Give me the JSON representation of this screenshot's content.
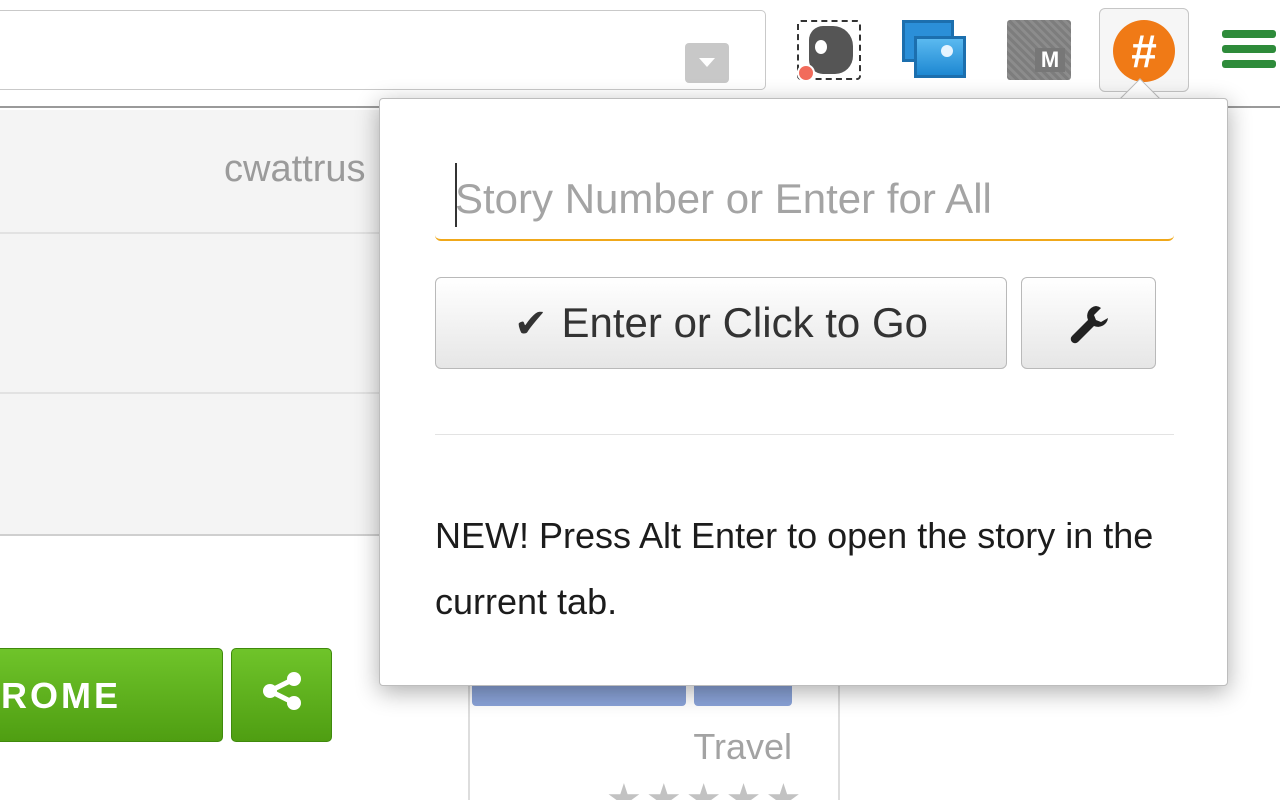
{
  "toolbar": {
    "extensions": [
      {
        "name": "evernote-web-clipper",
        "icon": "elephant-icon"
      },
      {
        "name": "image-extension",
        "icon": "images-icon"
      },
      {
        "name": "medium-extension",
        "icon": "m-icon",
        "glyph": "M"
      },
      {
        "name": "story-number-extension",
        "icon": "hash-icon",
        "glyph": "#",
        "color": "#f07a16"
      }
    ],
    "menu_icon": "hamburger-menu-icon"
  },
  "page": {
    "username": "cwattrus",
    "add_button_label": "ROME",
    "share_icon": "share-icon",
    "card": {
      "category": "Travel",
      "stars": "★★★★★"
    }
  },
  "popup": {
    "input_placeholder": "Story Number or Enter for All",
    "input_value": "",
    "go_button_label": "Enter or Click to Go",
    "go_button_icon": "checkmark-icon",
    "settings_icon": "wrench-icon",
    "note": "NEW! Press Alt Enter to open the story in the current tab.",
    "accent_color": "#f0a81a"
  }
}
